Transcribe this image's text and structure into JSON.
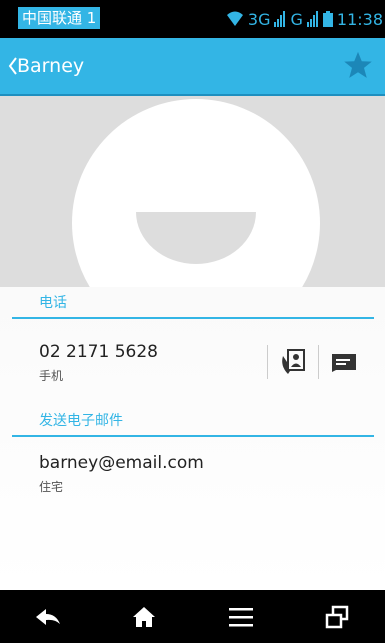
{
  "status_bar": {
    "carrier": "中国联通 1",
    "network_1": "3G",
    "network_2": "G",
    "time": "11:38"
  },
  "action_bar": {
    "contact_name": "Barney",
    "back_icon": "chevron-left-icon",
    "favorite_icon": "star-icon"
  },
  "phone_section": {
    "header": "电话",
    "number": "02 2171 5628",
    "type": "手机",
    "call_icon": "contact-call-icon",
    "sms_icon": "message-icon"
  },
  "email_section": {
    "header": "发送电子邮件",
    "address": "barney@email.com",
    "type": "住宅"
  },
  "nav_bar": {
    "icons": [
      "back-icon",
      "home-icon",
      "menu-icon",
      "recent-apps-icon"
    ]
  },
  "colors": {
    "accent": "#33b5e5",
    "photo_bg": "#dddddd",
    "status_bar_bg": "#000000"
  }
}
